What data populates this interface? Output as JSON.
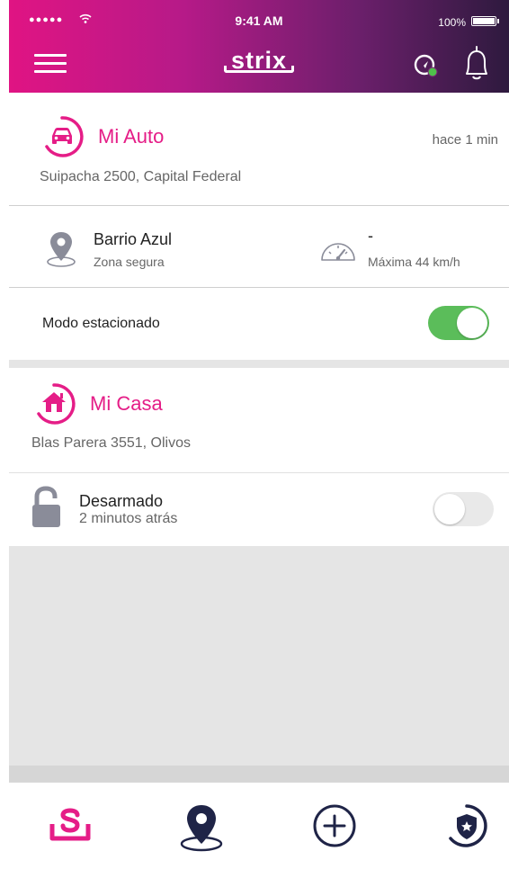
{
  "status_bar": {
    "signal": "●●●●●",
    "time": "9:41 AM",
    "battery": "100%"
  },
  "header": {
    "logo": "strix",
    "menu_icon": "hamburger-icon",
    "icons": [
      "driving-mode-icon",
      "bell-icon"
    ]
  },
  "auto": {
    "title": "Mi Auto",
    "updated": "hace 1 min",
    "address": "Suipacha 2500, Capital Federal",
    "zone_name": "Barrio Azul",
    "zone_label": "Zona segura",
    "speed_value": "-",
    "speed_label": "Máxima 44 km/h",
    "parking_label": "Modo estacionado",
    "parking_on": true
  },
  "casa": {
    "title": "Mi Casa",
    "address": "Blas Parera 3551, Olivos",
    "state": "Desarmado",
    "state_time": "2 minutos atrás",
    "armed": false
  },
  "nav": {
    "items": [
      "home-icon",
      "location-icon",
      "add-icon",
      "security-icon"
    ],
    "active": "home-icon"
  },
  "colors": {
    "accent": "#e51d87",
    "toggle_on": "#5bbd5a",
    "nav_dark": "#1f2447",
    "icon_gray": "#8a8c99"
  }
}
